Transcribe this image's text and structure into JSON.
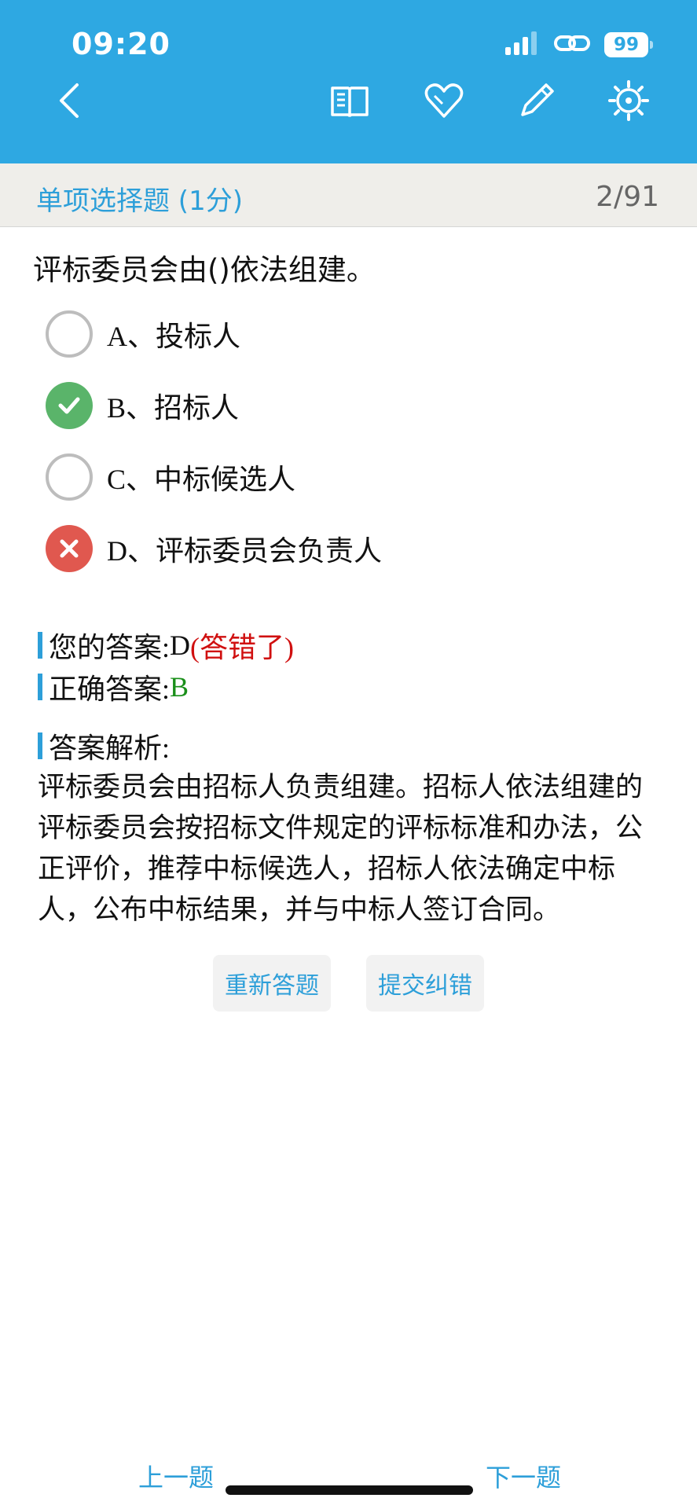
{
  "status_bar": {
    "time": "09:20",
    "battery": "99"
  },
  "header": {
    "icons": [
      "back-chevron-icon",
      "book-icon",
      "heart-icon",
      "pencil-icon",
      "settings-gear-icon"
    ]
  },
  "section": {
    "title": "单项选择题 (1分)",
    "progress": "2/91"
  },
  "question": {
    "text": "评标委员会由()依法组建。",
    "options": [
      {
        "label": "A、投标人",
        "state": "unselected"
      },
      {
        "label": "B、招标人",
        "state": "correct"
      },
      {
        "label": "C、中标候选人",
        "state": "unselected"
      },
      {
        "label": "D、评标委员会负责人",
        "state": "wrong"
      }
    ]
  },
  "answer": {
    "your_label": "您的答案:",
    "your_value": "D",
    "wrong_note": " (答错了)",
    "correct_label": "正确答案:",
    "correct_value": "B",
    "analysis_label": "答案解析:",
    "analysis_text": "评标委员会由招标人负责组建。招标人依法组建的评标委员会按招标文件规定的评标标准和办法，公正评价，推荐中标候选人，招标人依法确定中标人，公布中标结果，并与中标人签订合同。"
  },
  "buttons": {
    "retry": "重新答题",
    "report": "提交纠错"
  },
  "bottom_nav": {
    "prev": "上一题",
    "next": "下一题"
  },
  "colors": {
    "header_blue": "#2ea8e2",
    "accent_blue": "#2d9fd9",
    "correct_green": "#5ab46a",
    "wrong_red": "#e0584f"
  }
}
